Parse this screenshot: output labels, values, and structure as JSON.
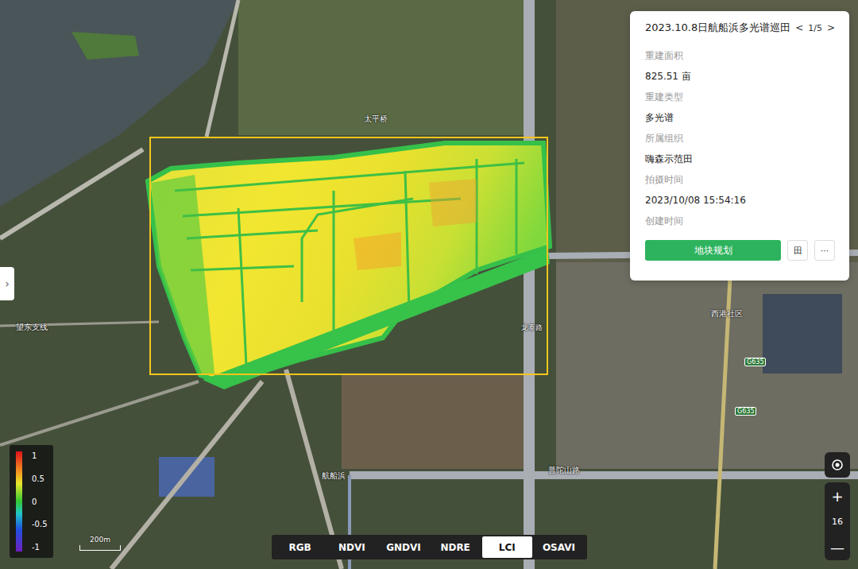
{
  "card": {
    "title": "2023.10.8日航船浜多光谱巡田",
    "prev": "<",
    "pager": "1/5",
    "next": ">",
    "fields": [
      {
        "label": "重建面积",
        "value": "825.51 亩"
      },
      {
        "label": "重建类型",
        "value": "多光谱"
      },
      {
        "label": "所属组织",
        "value": "嗨森示范田"
      },
      {
        "label": "拍摄时间",
        "value": "2023/10/08 15:54:16"
      },
      {
        "label": "创建时间"
      }
    ],
    "primary_button": "地块规划",
    "grid_button": "田",
    "more_button": "···"
  },
  "side_toggle": "›",
  "legend": {
    "ticks": [
      "1",
      "0.5",
      "0",
      "-0.5",
      "-1"
    ]
  },
  "scale": "200m",
  "index_tabs": [
    {
      "label": "RGB",
      "selected": false
    },
    {
      "label": "NDVI",
      "selected": false
    },
    {
      "label": "GNDVI",
      "selected": false
    },
    {
      "label": "NDRE",
      "selected": false
    },
    {
      "label": "LCI",
      "selected": true
    },
    {
      "label": "OSAVI",
      "selected": false
    }
  ],
  "zoom": {
    "plus": "+",
    "level": "16",
    "minus": "—"
  },
  "map_labels": [
    {
      "text": "太平桥",
      "kind": "place"
    },
    {
      "text": "望东支线",
      "kind": "place"
    },
    {
      "text": "航船浜",
      "kind": "place"
    },
    {
      "text": "西港社区",
      "kind": "place"
    },
    {
      "text": "G635",
      "kind": "badge"
    },
    {
      "text": "G635",
      "kind": "badge"
    },
    {
      "text": "普陀山路",
      "kind": "road"
    },
    {
      "text": "龙泰路",
      "kind": "vertical"
    }
  ]
}
